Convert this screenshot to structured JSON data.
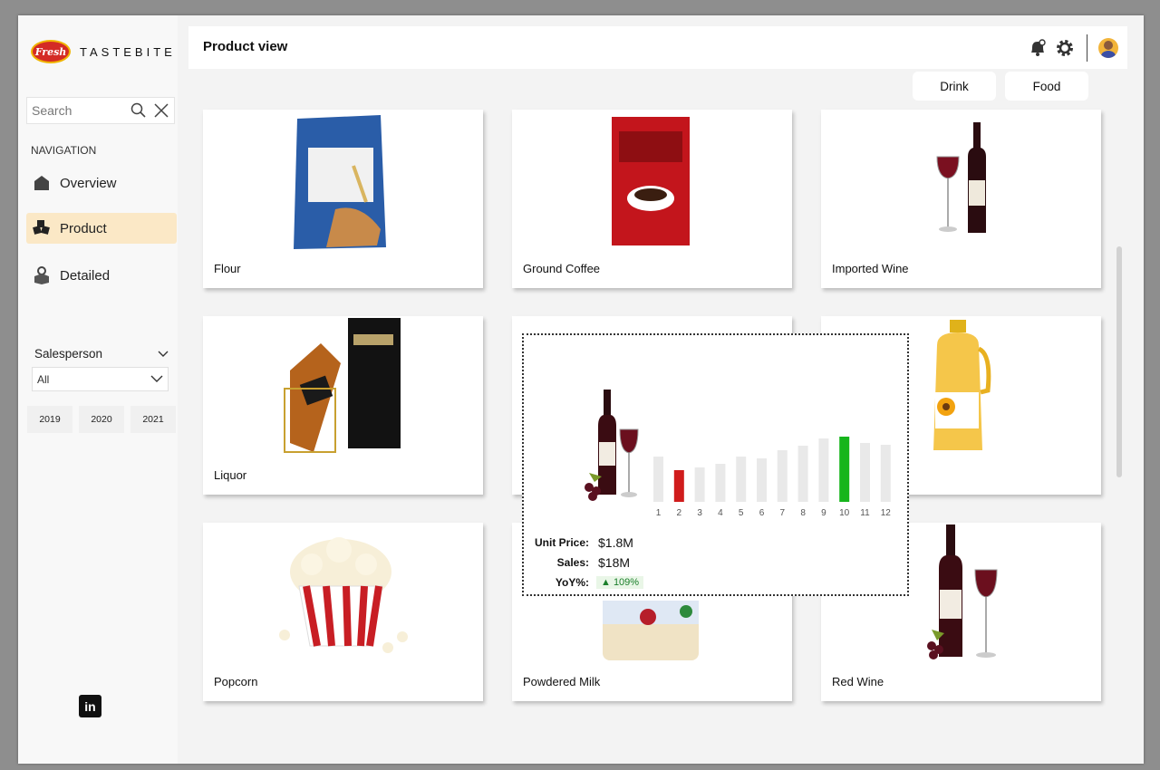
{
  "app": {
    "brand_badge": "Fresh",
    "brand_name": "TASTEBITE"
  },
  "search": {
    "placeholder": "Search"
  },
  "navigation": {
    "title": "NAVIGATION",
    "items": [
      {
        "label": "Overview",
        "icon": "house-icon",
        "active": false
      },
      {
        "label": "Product",
        "icon": "boxes-icon",
        "active": true
      },
      {
        "label": "Detailed",
        "icon": "gear-box-icon",
        "active": false
      }
    ]
  },
  "filters": {
    "salesperson_label": "Salesperson",
    "salesperson_value": "All",
    "years": [
      "2019",
      "2020",
      "2021"
    ]
  },
  "header": {
    "title": "Product view"
  },
  "category_buttons": [
    "Drink",
    "Food"
  ],
  "products": [
    {
      "label": "Flour",
      "image": "flour-bag"
    },
    {
      "label": "Ground Coffee",
      "image": "coffee-package"
    },
    {
      "label": "Imported Wine",
      "image": "wine-bottle-glass"
    },
    {
      "label": "Liquor",
      "image": "liquor-bottle-box"
    },
    {
      "label": "",
      "image": "hidden-by-tooltip"
    },
    {
      "label": "",
      "image": "oil-bottle"
    },
    {
      "label": "Popcorn",
      "image": "popcorn-bucket"
    },
    {
      "label": "Powdered Milk",
      "image": "milk-tin"
    },
    {
      "label": "Red Wine",
      "image": "red-wine-bottle"
    }
  ],
  "tooltip": {
    "unit_price_label": "Unit Price:",
    "unit_price_value": "$1.8M",
    "sales_label": "Sales:",
    "sales_value": "$18M",
    "yoy_label": "YoY%:",
    "yoy_value": "▲ 109%",
    "colors": {
      "normal": "#e9e9e9",
      "low": "#d01c1c",
      "high": "#16b51c"
    }
  },
  "chart_data": {
    "type": "bar",
    "categories": [
      "1",
      "2",
      "3",
      "4",
      "5",
      "6",
      "7",
      "8",
      "9",
      "10",
      "11",
      "12"
    ],
    "series": [
      {
        "values": [
          50,
          35,
          38,
          42,
          50,
          48,
          57,
          62,
          70,
          72,
          65,
          63
        ]
      }
    ],
    "highlight": {
      "min_index": 1,
      "max_index": 9
    },
    "ylim": [
      0,
      80
    ],
    "grid": false,
    "legend": "none"
  }
}
